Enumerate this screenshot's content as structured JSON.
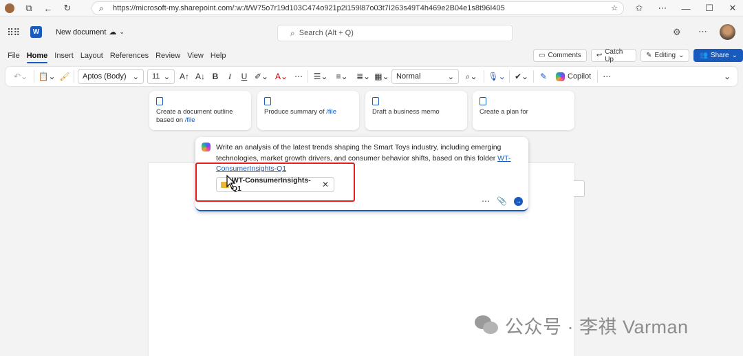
{
  "browser": {
    "url": "https://microsoft-my.sharepoint.com/:w:/t/W75o7r19d103C474o921p2i159l87o03t7I263s49T4h469e2B04e1s8t96I405"
  },
  "header": {
    "doc_title": "New document",
    "search_placeholder": "Search (Alt + Q)"
  },
  "tabs": [
    "File",
    "Home",
    "Insert",
    "Layout",
    "References",
    "Review",
    "View",
    "Help"
  ],
  "tab_actions": {
    "comments": "Comments",
    "catchup": "Catch Up",
    "editing": "Editing",
    "share": "Share"
  },
  "ribbon": {
    "font": "Aptos (Body)",
    "size": "11",
    "style": "Normal",
    "copilot": "Copilot"
  },
  "suggestions": [
    {
      "text": "Create a document outline based on ",
      "link": "/file"
    },
    {
      "text": "Produce summary of ",
      "link": "/file"
    },
    {
      "text": "Draft a business memo",
      "link": ""
    },
    {
      "text": "Create a plan for",
      "link": ""
    }
  ],
  "prompt": {
    "text": "Write an analysis of the latest trends shaping the Smart Toys industry, including emerging technologies, market growth drivers, and consumer behavior shifts, based on this folder",
    "link": "WT-ConsumerInsights-Q1",
    "chip": "WT-ConsumerInsights-Q1"
  },
  "watermark": "公众号 · 李祺 Varman",
  "colors": {
    "accent": "#185abd",
    "highlight": "#e02020"
  }
}
